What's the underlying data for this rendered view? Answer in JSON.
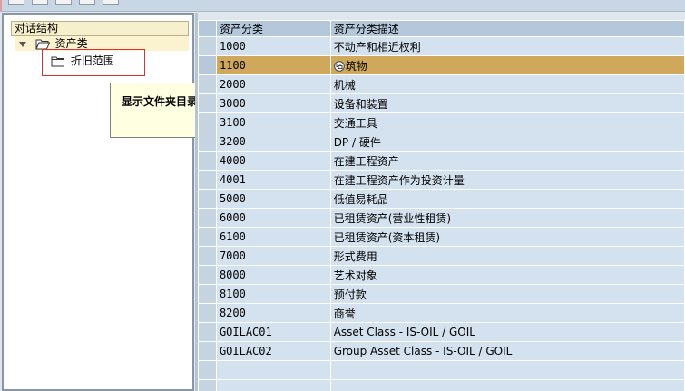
{
  "tree": {
    "header": "对话结构",
    "root_label": "资产类",
    "child_label": "折旧范围"
  },
  "tooltip": {
    "text": "显示文件夹目录"
  },
  "table": {
    "columns": [
      "资产分类",
      "资产分类描述"
    ],
    "rows": [
      {
        "code": "1000",
        "desc": "不动产和相近权利"
      },
      {
        "code": "1100",
        "desc": "筑物"
      },
      {
        "code": "2000",
        "desc": "机械"
      },
      {
        "code": "3000",
        "desc": "设备和装置"
      },
      {
        "code": "3100",
        "desc": "交通工具"
      },
      {
        "code": "3200",
        "desc": "DP / 硬件"
      },
      {
        "code": "4000",
        "desc": "在建工程资产"
      },
      {
        "code": "4001",
        "desc": "在建工程资产作为投资计量"
      },
      {
        "code": "5000",
        "desc": "低值易耗品"
      },
      {
        "code": "6000",
        "desc": "已租赁资产(营业性租赁)"
      },
      {
        "code": "6100",
        "desc": "已租赁资产(资本租赁)"
      },
      {
        "code": "7000",
        "desc": "形式费用"
      },
      {
        "code": "8000",
        "desc": "艺术对象"
      },
      {
        "code": "8100",
        "desc": "预付款"
      },
      {
        "code": "8200",
        "desc": "商誉"
      },
      {
        "code": "GOILAC01",
        "desc": "Asset Class - IS-OIL / GOIL"
      },
      {
        "code": "GOILAC02",
        "desc": "Group Asset Class - IS-OIL / GOIL"
      },
      {
        "code": "",
        "desc": ""
      },
      {
        "code": "",
        "desc": ""
      }
    ],
    "selected_row": 1
  },
  "colors": {
    "selected_row": "#d0a85c",
    "row_bg": "#d4e1ee",
    "header_bg": "#b5c8db",
    "highlight_border": "#e03030"
  }
}
